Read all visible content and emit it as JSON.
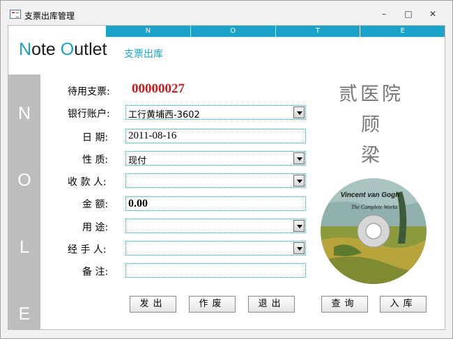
{
  "window": {
    "title": "支票出库管理",
    "controls": {
      "minimize": "–",
      "maximize": "□",
      "close": "✕"
    }
  },
  "header": {
    "strip_letters": [
      "N",
      "O",
      "T",
      "E"
    ],
    "brand": {
      "letter1": "N",
      "part1": "ote ",
      "letter2": "O",
      "part2": "utlet"
    },
    "subtitle": "支票出库",
    "accent_color": "#19a0c9"
  },
  "sidebar": {
    "letters": [
      "N",
      "O",
      "L",
      "E"
    ]
  },
  "form": {
    "cheque": {
      "label": "待用支票:",
      "value": "00000027"
    },
    "account": {
      "label": "银行账户:",
      "value": "工行黄埔西-3602"
    },
    "date": {
      "label": "日  期:",
      "value": "2011-08-16"
    },
    "nature": {
      "label": "性  质:",
      "value": "现付"
    },
    "payee": {
      "label": "收 款 人:",
      "value": ""
    },
    "amount": {
      "label": "金  额:",
      "value": "0.00"
    },
    "purpose": {
      "label": "用  途:",
      "value": ""
    },
    "handler": {
      "label": "经 手 人:",
      "value": ""
    },
    "remark": {
      "label": "备  注:",
      "value": ""
    }
  },
  "calligraphy": {
    "line1": "贰医院",
    "line2": "顾",
    "line3": "梁"
  },
  "cd": {
    "title": "Vincent van Gogh",
    "subtitle": "The Complete Works"
  },
  "buttons": {
    "issue": "发出",
    "void": "作废",
    "exit": "退出",
    "query": "查询",
    "stock_in": "入库"
  }
}
